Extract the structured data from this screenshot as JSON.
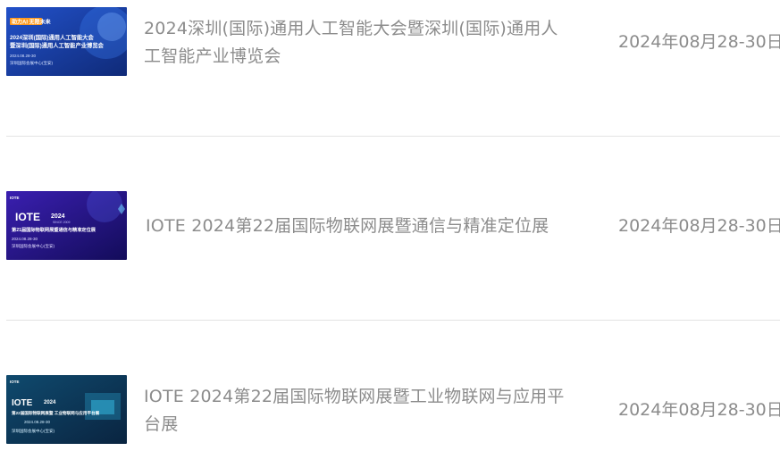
{
  "events": [
    {
      "title": "2024深圳(国际)通用人工智能大会暨深圳(国际)通用人工智能产业博览会",
      "date": "2024年08月28-30日",
      "thumb": {
        "tag": "助力AI 无限未来",
        "line1": "2024深圳(国际)通用人工智能大会",
        "line2": "暨深圳(国际)通用人工智能产业博览会",
        "date": "2024.08.28-30",
        "venue": "深圳国际会展中心(宝安)"
      }
    },
    {
      "title": "IOTE 2024第22届国际物联网展暨通信与精准定位展",
      "date": "2024年08月28-30日",
      "thumb": {
        "brand": "IOTE",
        "year": "2024",
        "since": "SINCE 2009",
        "line1": "第21届国际物联网展暨通信与精准定位展",
        "date": "2024.08.28-30",
        "venue": "深圳国际会展中心(宝安)"
      }
    },
    {
      "title": "IOTE 2024第22届国际物联网展暨工业物联网与应用平台展",
      "date": "2024年08月28-30日",
      "thumb": {
        "brand": "IOTE",
        "year": "2024",
        "line1": "第22届国际物联网展暨 工业物联网与应用平台展",
        "date": "2024.08.28-30",
        "venue": "深圳国际会展中心(宝安)"
      }
    }
  ],
  "colors": {
    "text": "#8c8c8c",
    "divider": "#e3e3e3",
    "thumb1_bg": "#1b3fa8",
    "thumb2_bg": "#2a1a8c",
    "thumb3_bg": "#0d3b5e"
  }
}
